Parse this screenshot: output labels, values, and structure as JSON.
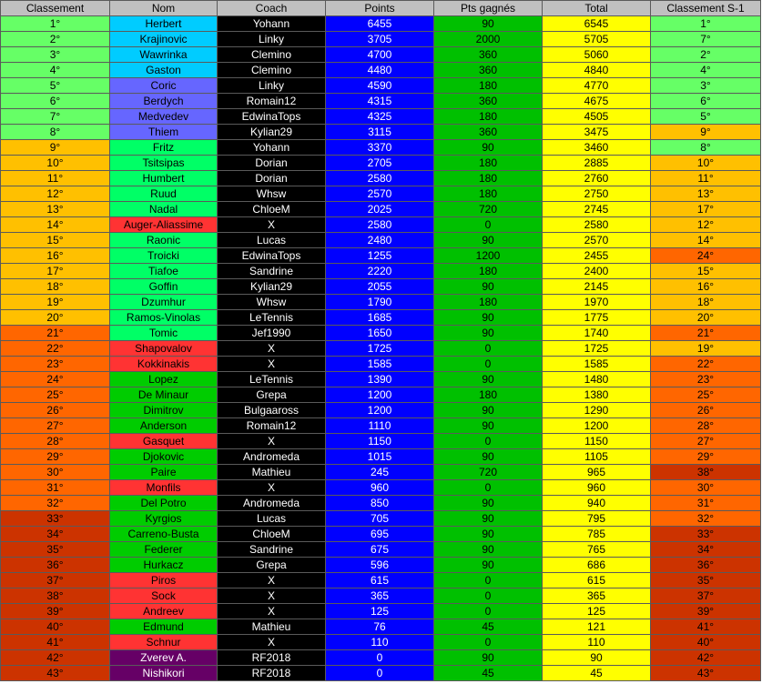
{
  "palette": {
    "tier_green": "#66ff66",
    "tier_yellow": "#ffc000",
    "tier_orange": "#ff6600",
    "tier_red": "#cc3300",
    "nom_cyan": "#00ccff",
    "nom_violet": "#6666ff",
    "nom_lightgreen": "#00ff66",
    "nom_red": "#ff3333",
    "nom_green": "#00cc00",
    "nom_purple": "#660066",
    "coach_bg": "#000000",
    "points_bg": "#0000ff",
    "gained_bg": "#00c000",
    "total_bg": "#ffff00",
    "header_bg": "#c0c0c0"
  },
  "table": {
    "headers": [
      "Classement",
      "Nom",
      "Coach",
      "Points",
      "Pts gagnés",
      "Total",
      "Classement S-1"
    ],
    "rows": [
      {
        "rank": "1°",
        "name": "Herbert",
        "coach": "Yohann",
        "points": "6455",
        "gained": "90",
        "total": "6545",
        "prev": "1°",
        "rank_tier": "green",
        "name_tier": "cyan",
        "prev_tier": "green"
      },
      {
        "rank": "2°",
        "name": "Krajinovic",
        "coach": "Linky",
        "points": "3705",
        "gained": "2000",
        "total": "5705",
        "prev": "7°",
        "rank_tier": "green",
        "name_tier": "cyan",
        "prev_tier": "green"
      },
      {
        "rank": "3°",
        "name": "Wawrinka",
        "coach": "Clemino",
        "points": "4700",
        "gained": "360",
        "total": "5060",
        "prev": "2°",
        "rank_tier": "green",
        "name_tier": "cyan",
        "prev_tier": "green"
      },
      {
        "rank": "4°",
        "name": "Gaston",
        "coach": "Clemino",
        "points": "4480",
        "gained": "360",
        "total": "4840",
        "prev": "4°",
        "rank_tier": "green",
        "name_tier": "cyan",
        "prev_tier": "green"
      },
      {
        "rank": "5°",
        "name": "Coric",
        "coach": "Linky",
        "points": "4590",
        "gained": "180",
        "total": "4770",
        "prev": "3°",
        "rank_tier": "green",
        "name_tier": "violet",
        "prev_tier": "green"
      },
      {
        "rank": "6°",
        "name": "Berdych",
        "coach": "Romain12",
        "points": "4315",
        "gained": "360",
        "total": "4675",
        "prev": "6°",
        "rank_tier": "green",
        "name_tier": "violet",
        "prev_tier": "green"
      },
      {
        "rank": "7°",
        "name": "Medvedev",
        "coach": "EdwinaTops",
        "points": "4325",
        "gained": "180",
        "total": "4505",
        "prev": "5°",
        "rank_tier": "green",
        "name_tier": "violet",
        "prev_tier": "green"
      },
      {
        "rank": "8°",
        "name": "Thiem",
        "coach": "Kylian29",
        "points": "3115",
        "gained": "360",
        "total": "3475",
        "prev": "9°",
        "rank_tier": "green",
        "name_tier": "violet",
        "prev_tier": "yellow"
      },
      {
        "rank": "9°",
        "name": "Fritz",
        "coach": "Yohann",
        "points": "3370",
        "gained": "90",
        "total": "3460",
        "prev": "8°",
        "rank_tier": "yellow",
        "name_tier": "lightgreen",
        "prev_tier": "green"
      },
      {
        "rank": "10°",
        "name": "Tsitsipas",
        "coach": "Dorian",
        "points": "2705",
        "gained": "180",
        "total": "2885",
        "prev": "10°",
        "rank_tier": "yellow",
        "name_tier": "lightgreen",
        "prev_tier": "yellow"
      },
      {
        "rank": "11°",
        "name": "Humbert",
        "coach": "Dorian",
        "points": "2580",
        "gained": "180",
        "total": "2760",
        "prev": "11°",
        "rank_tier": "yellow",
        "name_tier": "lightgreen",
        "prev_tier": "yellow"
      },
      {
        "rank": "12°",
        "name": "Ruud",
        "coach": "Whsw",
        "points": "2570",
        "gained": "180",
        "total": "2750",
        "prev": "13°",
        "rank_tier": "yellow",
        "name_tier": "lightgreen",
        "prev_tier": "yellow"
      },
      {
        "rank": "13°",
        "name": "Nadal",
        "coach": "ChloeM",
        "points": "2025",
        "gained": "720",
        "total": "2745",
        "prev": "17°",
        "rank_tier": "yellow",
        "name_tier": "lightgreen",
        "prev_tier": "yellow"
      },
      {
        "rank": "14°",
        "name": "Auger-Aliassime",
        "coach": "X",
        "points": "2580",
        "gained": "0",
        "total": "2580",
        "prev": "12°",
        "rank_tier": "yellow",
        "name_tier": "red",
        "prev_tier": "yellow"
      },
      {
        "rank": "15°",
        "name": "Raonic",
        "coach": "Lucas",
        "points": "2480",
        "gained": "90",
        "total": "2570",
        "prev": "14°",
        "rank_tier": "yellow",
        "name_tier": "lightgreen",
        "prev_tier": "yellow"
      },
      {
        "rank": "16°",
        "name": "Troicki",
        "coach": "EdwinaTops",
        "points": "1255",
        "gained": "1200",
        "total": "2455",
        "prev": "24°",
        "rank_tier": "yellow",
        "name_tier": "lightgreen",
        "prev_tier": "orange"
      },
      {
        "rank": "17°",
        "name": "Tiafoe",
        "coach": "Sandrine",
        "points": "2220",
        "gained": "180",
        "total": "2400",
        "prev": "15°",
        "rank_tier": "yellow",
        "name_tier": "lightgreen",
        "prev_tier": "yellow"
      },
      {
        "rank": "18°",
        "name": "Goffin",
        "coach": "Kylian29",
        "points": "2055",
        "gained": "90",
        "total": "2145",
        "prev": "16°",
        "rank_tier": "yellow",
        "name_tier": "lightgreen",
        "prev_tier": "yellow"
      },
      {
        "rank": "19°",
        "name": "Dzumhur",
        "coach": "Whsw",
        "points": "1790",
        "gained": "180",
        "total": "1970",
        "prev": "18°",
        "rank_tier": "yellow",
        "name_tier": "lightgreen",
        "prev_tier": "yellow"
      },
      {
        "rank": "20°",
        "name": "Ramos-Vinolas",
        "coach": "LeTennis",
        "points": "1685",
        "gained": "90",
        "total": "1775",
        "prev": "20°",
        "rank_tier": "yellow",
        "name_tier": "lightgreen",
        "prev_tier": "yellow"
      },
      {
        "rank": "21°",
        "name": "Tomic",
        "coach": "Jef1990",
        "points": "1650",
        "gained": "90",
        "total": "1740",
        "prev": "21°",
        "rank_tier": "orange",
        "name_tier": "lightgreen",
        "prev_tier": "orange"
      },
      {
        "rank": "22°",
        "name": "Shapovalov",
        "coach": "X",
        "points": "1725",
        "gained": "0",
        "total": "1725",
        "prev": "19°",
        "rank_tier": "orange",
        "name_tier": "red",
        "prev_tier": "yellow"
      },
      {
        "rank": "23°",
        "name": "Kokkinakis",
        "coach": "X",
        "points": "1585",
        "gained": "0",
        "total": "1585",
        "prev": "22°",
        "rank_tier": "orange",
        "name_tier": "red",
        "prev_tier": "orange"
      },
      {
        "rank": "24°",
        "name": "Lopez",
        "coach": "LeTennis",
        "points": "1390",
        "gained": "90",
        "total": "1480",
        "prev": "23°",
        "rank_tier": "orange",
        "name_tier": "green",
        "prev_tier": "orange"
      },
      {
        "rank": "25°",
        "name": "De Minaur",
        "coach": "Grepa",
        "points": "1200",
        "gained": "180",
        "total": "1380",
        "prev": "25°",
        "rank_tier": "orange",
        "name_tier": "green",
        "prev_tier": "orange"
      },
      {
        "rank": "26°",
        "name": "Dimitrov",
        "coach": "Bulgaaross",
        "points": "1200",
        "gained": "90",
        "total": "1290",
        "prev": "26°",
        "rank_tier": "orange",
        "name_tier": "green",
        "prev_tier": "orange"
      },
      {
        "rank": "27°",
        "name": "Anderson",
        "coach": "Romain12",
        "points": "1110",
        "gained": "90",
        "total": "1200",
        "prev": "28°",
        "rank_tier": "orange",
        "name_tier": "green",
        "prev_tier": "orange"
      },
      {
        "rank": "28°",
        "name": "Gasquet",
        "coach": "X",
        "points": "1150",
        "gained": "0",
        "total": "1150",
        "prev": "27°",
        "rank_tier": "orange",
        "name_tier": "red",
        "prev_tier": "orange"
      },
      {
        "rank": "29°",
        "name": "Djokovic",
        "coach": "Andromeda",
        "points": "1015",
        "gained": "90",
        "total": "1105",
        "prev": "29°",
        "rank_tier": "orange",
        "name_tier": "green",
        "prev_tier": "orange"
      },
      {
        "rank": "30°",
        "name": "Paire",
        "coach": "Mathieu",
        "points": "245",
        "gained": "720",
        "total": "965",
        "prev": "38°",
        "rank_tier": "orange",
        "name_tier": "green",
        "prev_tier": "red"
      },
      {
        "rank": "31°",
        "name": "Monfils",
        "coach": "X",
        "points": "960",
        "gained": "0",
        "total": "960",
        "prev": "30°",
        "rank_tier": "orange",
        "name_tier": "red",
        "prev_tier": "orange"
      },
      {
        "rank": "32°",
        "name": "Del Potro",
        "coach": "Andromeda",
        "points": "850",
        "gained": "90",
        "total": "940",
        "prev": "31°",
        "rank_tier": "orange",
        "name_tier": "green",
        "prev_tier": "orange"
      },
      {
        "rank": "33°",
        "name": "Kyrgios",
        "coach": "Lucas",
        "points": "705",
        "gained": "90",
        "total": "795",
        "prev": "32°",
        "rank_tier": "red",
        "name_tier": "green",
        "prev_tier": "orange"
      },
      {
        "rank": "34°",
        "name": "Carreno-Busta",
        "coach": "ChloeM",
        "points": "695",
        "gained": "90",
        "total": "785",
        "prev": "33°",
        "rank_tier": "red",
        "name_tier": "green",
        "prev_tier": "red"
      },
      {
        "rank": "35°",
        "name": "Federer",
        "coach": "Sandrine",
        "points": "675",
        "gained": "90",
        "total": "765",
        "prev": "34°",
        "rank_tier": "red",
        "name_tier": "green",
        "prev_tier": "red"
      },
      {
        "rank": "36°",
        "name": "Hurkacz",
        "coach": "Grepa",
        "points": "596",
        "gained": "90",
        "total": "686",
        "prev": "36°",
        "rank_tier": "red",
        "name_tier": "green",
        "prev_tier": "red"
      },
      {
        "rank": "37°",
        "name": "Piros",
        "coach": "X",
        "points": "615",
        "gained": "0",
        "total": "615",
        "prev": "35°",
        "rank_tier": "red",
        "name_tier": "red",
        "prev_tier": "red"
      },
      {
        "rank": "38°",
        "name": "Sock",
        "coach": "X",
        "points": "365",
        "gained": "0",
        "total": "365",
        "prev": "37°",
        "rank_tier": "red",
        "name_tier": "red",
        "prev_tier": "red"
      },
      {
        "rank": "39°",
        "name": "Andreev",
        "coach": "X",
        "points": "125",
        "gained": "0",
        "total": "125",
        "prev": "39°",
        "rank_tier": "red",
        "name_tier": "red",
        "prev_tier": "red"
      },
      {
        "rank": "40°",
        "name": "Edmund",
        "coach": "Mathieu",
        "points": "76",
        "gained": "45",
        "total": "121",
        "prev": "41°",
        "rank_tier": "red",
        "name_tier": "green",
        "prev_tier": "red"
      },
      {
        "rank": "41°",
        "name": "Schnur",
        "coach": "X",
        "points": "110",
        "gained": "0",
        "total": "110",
        "prev": "40°",
        "rank_tier": "red",
        "name_tier": "red",
        "prev_tier": "red"
      },
      {
        "rank": "42°",
        "name": "Zverev A.",
        "coach": "RF2018",
        "points": "0",
        "gained": "90",
        "total": "90",
        "prev": "42°",
        "rank_tier": "red",
        "name_tier": "purple",
        "prev_tier": "red"
      },
      {
        "rank": "43°",
        "name": "Nishikori",
        "coach": "RF2018",
        "points": "0",
        "gained": "45",
        "total": "45",
        "prev": "43°",
        "rank_tier": "red",
        "name_tier": "purple",
        "prev_tier": "red"
      }
    ]
  }
}
